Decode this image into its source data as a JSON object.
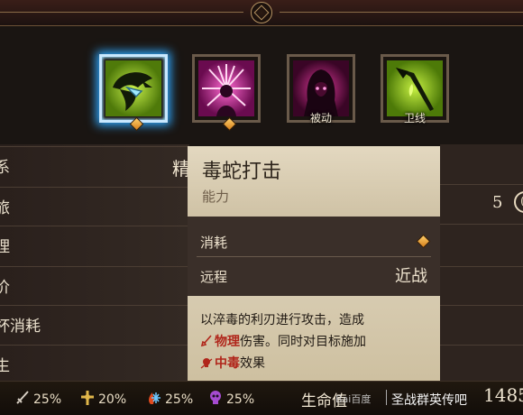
{
  "skills": [
    {
      "name": "poison-snake",
      "tag": "",
      "selected": true
    },
    {
      "name": "radiant-burst",
      "tag": "",
      "selected": false
    },
    {
      "name": "hooded-figure",
      "tag": "被动",
      "selected": false
    },
    {
      "name": "green-spear",
      "tag": "卫线",
      "selected": false
    }
  ],
  "left_rows": [
    "系",
    "旅",
    "理",
    "价",
    "杯消耗",
    "生"
  ],
  "partial_char": "精",
  "right_value": "5",
  "right_circle": "(",
  "tooltip": {
    "title": "毒蛇打击",
    "subtitle": "能力",
    "cost_label": "消耗",
    "range_label": "远程",
    "range_value": "近战",
    "desc_line1": "以淬毒的利刃进行攻击，造成",
    "desc_physical": "物理",
    "desc_line2_rest": "伤害。同时对目标施加",
    "desc_poison": "中毒",
    "desc_line3_rest": "效果"
  },
  "resources": [
    {
      "icon": "sword-icon",
      "value": "25%"
    },
    {
      "icon": "cross-icon",
      "value": "20%"
    },
    {
      "icon": "fire-frost-icon",
      "value": "25%"
    },
    {
      "icon": "skull-icon",
      "value": "25%"
    }
  ],
  "life_label": "生命值",
  "watermark_logo": "Bai百度",
  "watermark_text": "圣战群英传吧",
  "big_number": "1485",
  "colors": {
    "accent_gold": "#d9952a",
    "selected_glow": "#2fa8ff",
    "physical_red": "#b0251a"
  }
}
